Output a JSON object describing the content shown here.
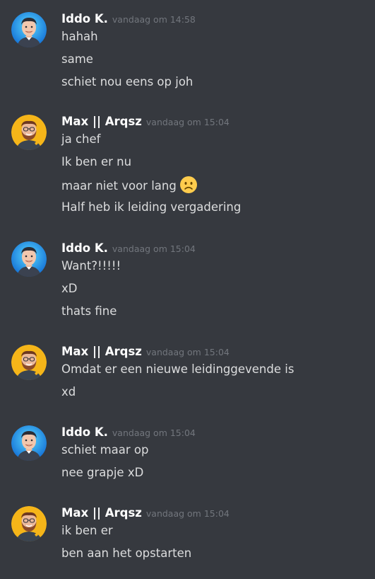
{
  "users": {
    "iddo": {
      "name": "Iddo K."
    },
    "max": {
      "name": "Max || Arqsz"
    }
  },
  "groups": [
    {
      "user": "iddo",
      "time": "vandaag om 14:58",
      "lines": [
        "hahah",
        "same",
        "schiet nou eens op joh"
      ]
    },
    {
      "user": "max",
      "time": "vandaag om 15:04",
      "lines": [
        "ja chef",
        "Ik ben er nu",
        "maar niet voor lang",
        "Half heb ik leiding vergadering"
      ],
      "emoji_line": 2,
      "emoji": "frowning-face-icon"
    },
    {
      "user": "iddo",
      "time": "vandaag om 15:04",
      "lines": [
        "Want?!!!!!",
        "xD",
        "thats fine"
      ]
    },
    {
      "user": "max",
      "time": "vandaag om 15:04",
      "lines": [
        "Omdat er een nieuwe leidinggevende is",
        "xd"
      ]
    },
    {
      "user": "iddo",
      "time": "vandaag om 15:04",
      "lines": [
        "schiet maar op",
        "nee grapje xD"
      ]
    },
    {
      "user": "max",
      "time": "vandaag om 15:04",
      "lines": [
        "ik ben er",
        "ben aan het opstarten"
      ]
    }
  ],
  "colors": {
    "background": "#36393f",
    "username": "#ffffff",
    "timestamp": "#72767d",
    "message_text": "#dcddde",
    "iddo_avatar_bg": "#1e8fe0",
    "max_avatar_bg": "#f5b519",
    "emoji_face": "#ffcc4d"
  }
}
